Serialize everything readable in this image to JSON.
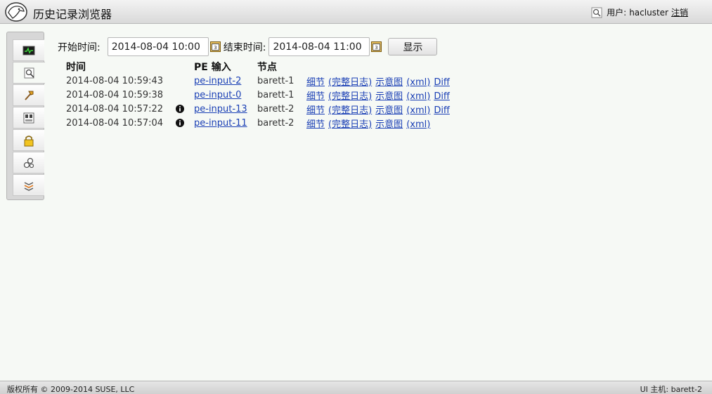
{
  "header": {
    "title": "历史记录浏览器",
    "user_label": "用户:",
    "username": "hacluster",
    "logout": "注销"
  },
  "sidebar": {
    "items": [
      {
        "name": "status-icon"
      },
      {
        "name": "history-explorer-icon"
      },
      {
        "name": "tools-icon"
      },
      {
        "name": "resources-icon"
      },
      {
        "name": "access-control-icon"
      },
      {
        "name": "configuration-icon"
      },
      {
        "name": "wizard-icon"
      }
    ]
  },
  "filter": {
    "start_label": "开始时间:",
    "start_value": "2014-08-04 10:00",
    "end_label": "结束时间:",
    "end_value": "2014-08-04 11:00",
    "show_button": "显示"
  },
  "table": {
    "headers": {
      "time": "时间",
      "pe_input": "PE 输入",
      "node": "节点"
    },
    "rows": [
      {
        "time": "2014-08-04 10:59:43",
        "info": false,
        "pe": "pe-input-2",
        "node": "barett-1",
        "details": "细节",
        "full_log": "(完整日志)",
        "graph": "示意图",
        "xml": "(xml)",
        "diff": "Diff"
      },
      {
        "time": "2014-08-04 10:59:38",
        "info": false,
        "pe": "pe-input-0",
        "node": "barett-1",
        "details": "细节",
        "full_log": "(完整日志)",
        "graph": "示意图",
        "xml": "(xml)",
        "diff": "Diff"
      },
      {
        "time": "2014-08-04 10:57:22",
        "info": true,
        "pe": "pe-input-13",
        "node": "barett-2",
        "details": "细节",
        "full_log": "(完整日志)",
        "graph": "示意图",
        "xml": "(xml)",
        "diff": "Diff"
      },
      {
        "time": "2014-08-04 10:57:04",
        "info": true,
        "pe": "pe-input-11",
        "node": "barett-2",
        "details": "细节",
        "full_log": "(完整日志)",
        "graph": "示意图",
        "xml": "(xml)",
        "diff": ""
      }
    ]
  },
  "footer": {
    "copyright": "版权所有 © 2009-2014 SUSE, LLC",
    "ui_host_label": "UI 主机:",
    "ui_host": "barett-2"
  },
  "colors": {
    "link": "#1a3fb5",
    "background": "#f6f9f5"
  }
}
